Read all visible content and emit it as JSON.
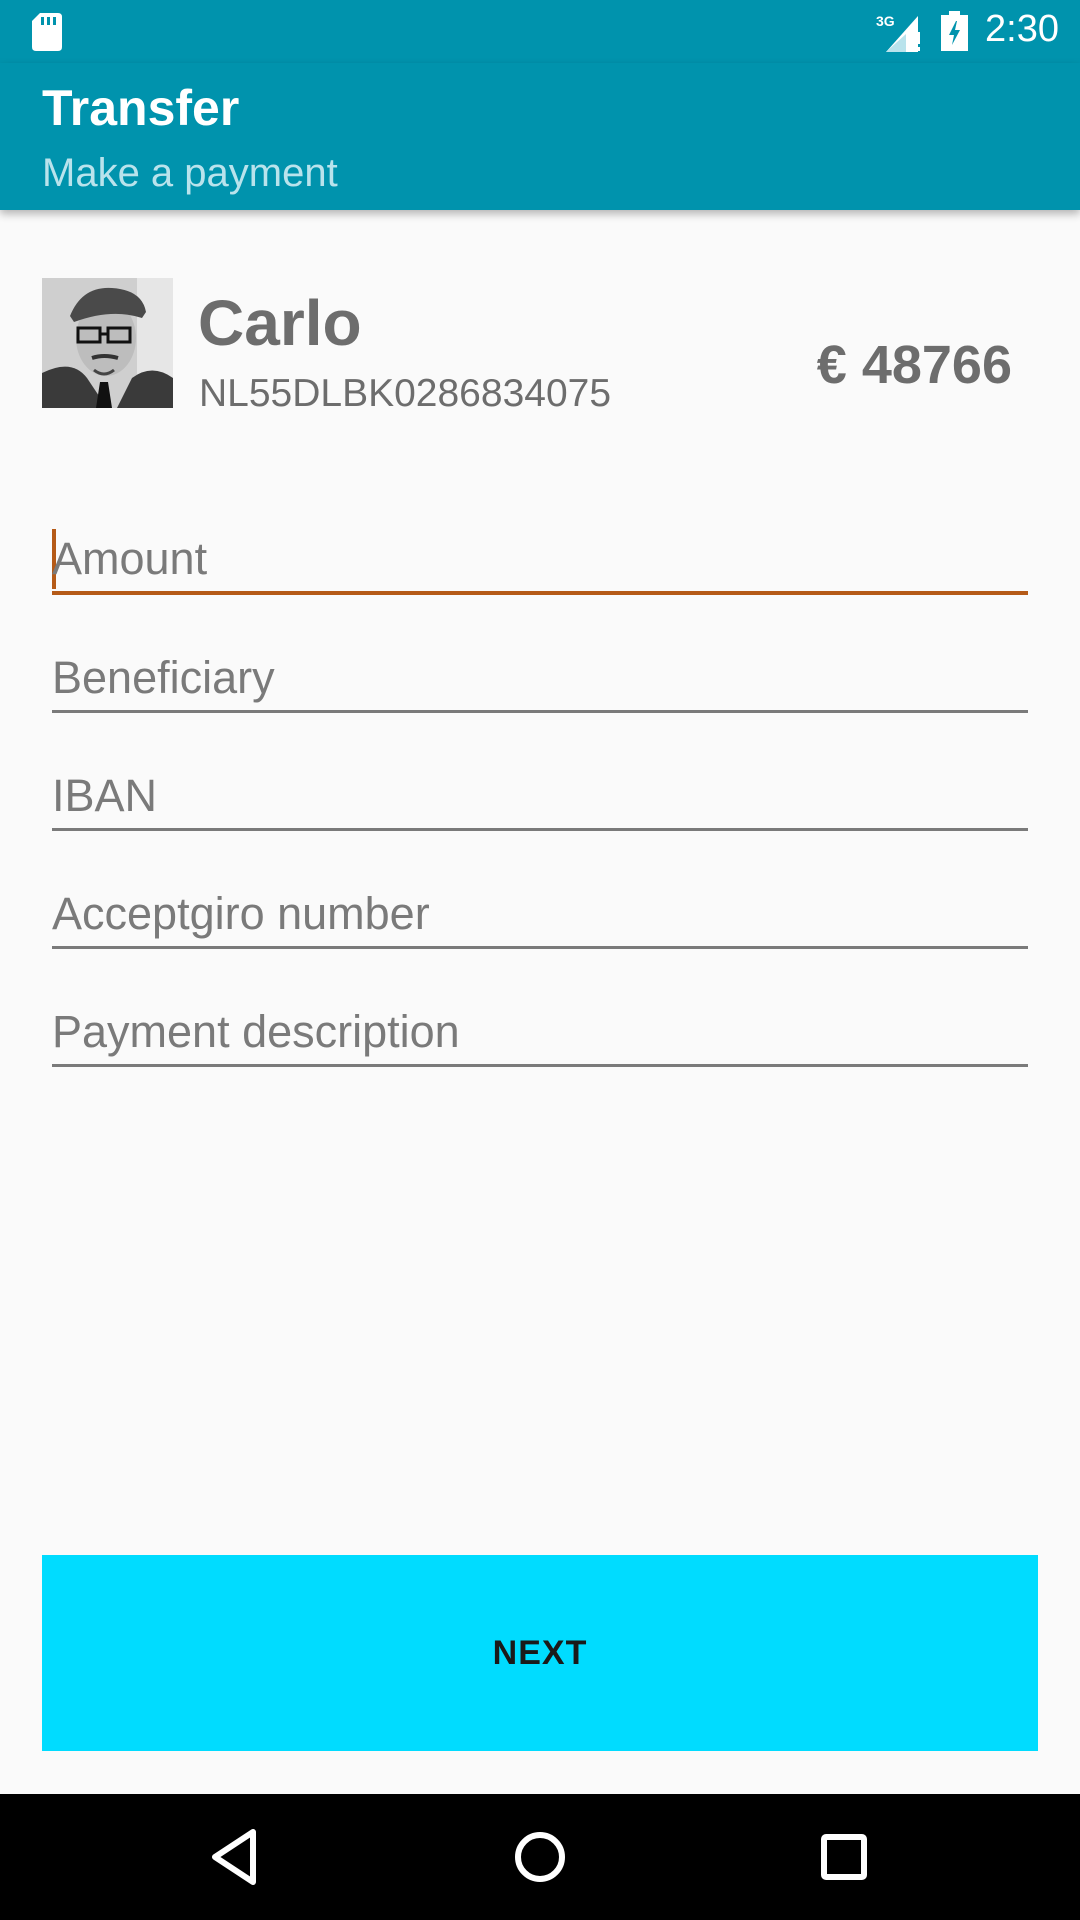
{
  "status_bar": {
    "time": "2:30",
    "network": "3G",
    "icons": [
      "sd-card-icon",
      "signal-3g-icon",
      "battery-charging-icon"
    ]
  },
  "app_bar": {
    "title": "Transfer",
    "subtitle": "Make a payment"
  },
  "account": {
    "name": "Carlo",
    "iban": "NL55DLBK0286834075",
    "balance": "€ 48766",
    "avatar_icon": "profile-photo"
  },
  "form": {
    "amount_placeholder": "Amount",
    "beneficiary_placeholder": "Beneficiary",
    "iban_placeholder": "IBAN",
    "acceptgiro_placeholder": "Acceptgiro number",
    "description_placeholder": "Payment description"
  },
  "actions": {
    "next_label": "NEXT"
  },
  "colors": {
    "primary": "#0093ad",
    "accent": "#b55a17",
    "button": "#00dcff"
  },
  "nav_bar": {
    "icons": [
      "back-icon",
      "home-icon",
      "recents-icon"
    ]
  }
}
